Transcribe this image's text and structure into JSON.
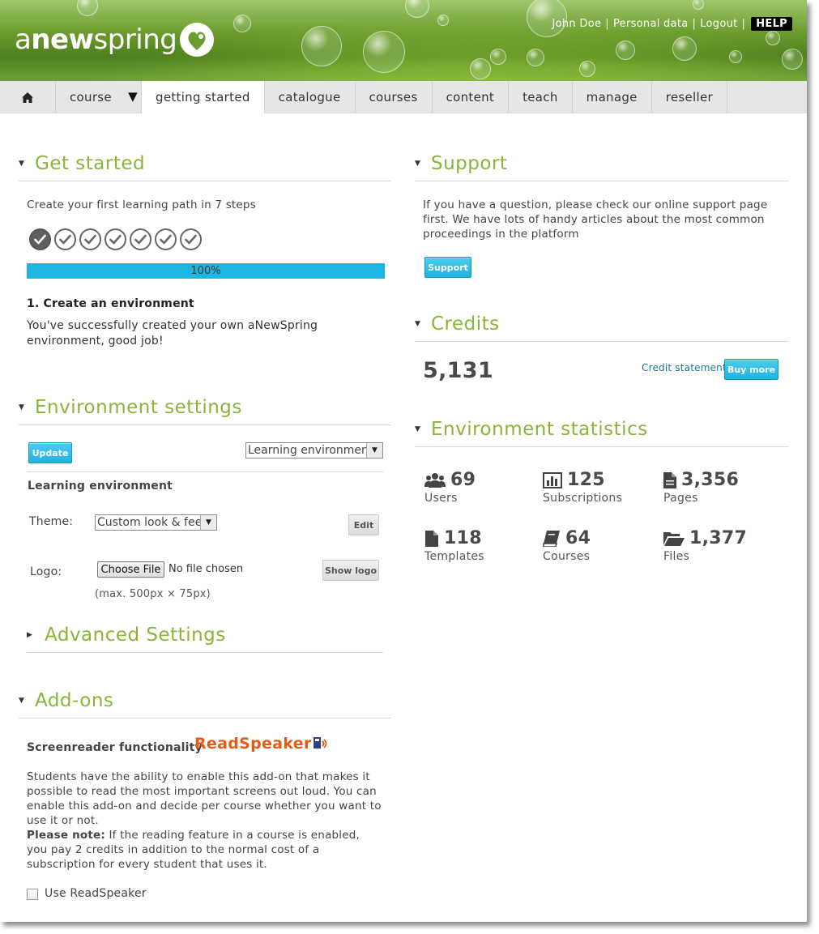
{
  "header": {
    "logo_a": "a",
    "logo_new": "new",
    "logo_spring": "spring",
    "user_name": "John Doe",
    "personal_data": "Personal data",
    "logout": "Logout",
    "help": "HELP",
    "separator": "|"
  },
  "nav": {
    "home_icon": "home-icon",
    "items": [
      "course",
      "getting started",
      "catalogue",
      "courses",
      "content",
      "teach",
      "manage",
      "reseller"
    ],
    "active": "getting started",
    "caret": "▼"
  },
  "get_started": {
    "title": "Get started",
    "subtitle": "Create your first learning path in 7 steps",
    "steps_total": 7,
    "steps_done": 1,
    "progress": 1.0,
    "progress_label": "100%",
    "step_title": "1. Create an environment",
    "step_text": "You've successfully created your own aNewSpring environment, good job!"
  },
  "environment_settings": {
    "title": "Environment settings",
    "update_label": "Update",
    "selector_value": "Learning environment",
    "section_label": "Learning environment",
    "theme_label": "Theme:",
    "theme_value": "Custom look & feel",
    "edit_label": "Edit",
    "logo_label": "Logo:",
    "choose_file": "Choose File",
    "no_file": "No file chosen",
    "show_logo": "Show logo",
    "logo_hint": "(max. 500px × 75px)"
  },
  "advanced_settings": {
    "title": "Advanced Settings"
  },
  "addons": {
    "title": "Add-ons",
    "screenreader_label": "Screenreader functionality",
    "readspeaker_logo": "ReadSpeaker",
    "description": "Students have the ability to enable this add-on that makes it possible to read the most important screens out loud. You can enable this add-on and decide per course whether you want to use it or not.",
    "note_bold": "Please note:",
    "note_text": " If the reading feature in a course is enabled, you pay 2 credits in addition to the normal cost of a subscription for every student that uses it.",
    "checkbox_label": "Use ReadSpeaker",
    "checkbox_checked": false
  },
  "support": {
    "title": "Support",
    "text": "If you have a question, please check our online support page first. We have lots of handy articles about the most common proceedings in the platform",
    "button": "Support"
  },
  "credits": {
    "title": "Credits",
    "amount": "5,131",
    "statement_link": "Credit statement",
    "buy_more": "Buy more"
  },
  "statistics": {
    "title": "Environment statistics",
    "items": [
      {
        "icon": "users-icon",
        "value": "69",
        "label": "Users"
      },
      {
        "icon": "bar-chart-icon",
        "value": "125",
        "label": "Subscriptions"
      },
      {
        "icon": "page-icon",
        "value": "3,356",
        "label": "Pages"
      },
      {
        "icon": "template-icon",
        "value": "118",
        "label": "Templates"
      },
      {
        "icon": "book-icon",
        "value": "64",
        "label": "Courses"
      },
      {
        "icon": "folder-open-icon",
        "value": "1,377",
        "label": "Files"
      }
    ]
  },
  "colors": {
    "accent_green": "#8ab53a",
    "button_blue": "#1fb2de",
    "progress_blue": "#1eb5e2",
    "link_teal": "#1b7a8c"
  }
}
